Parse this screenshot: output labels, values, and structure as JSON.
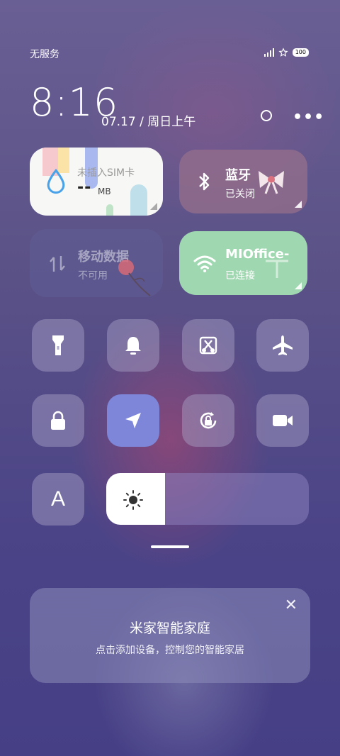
{
  "status": {
    "carrier": "无服务",
    "battery": "100"
  },
  "clock": {
    "time": "8:16",
    "date": "07.17 / 周日上午"
  },
  "tiles": {
    "data": {
      "title": "未插入SIM卡",
      "value": "--",
      "unit": "MB"
    },
    "bluetooth": {
      "title": "蓝牙",
      "status": "已关闭"
    },
    "mobile": {
      "title": "移动数据",
      "status": "不可用"
    },
    "wifi": {
      "title": "MIOffice-",
      "status": "已连接"
    }
  },
  "toggles": [
    {
      "name": "flashlight-icon",
      "active": false
    },
    {
      "name": "bell-icon",
      "active": false
    },
    {
      "name": "screenshot-icon",
      "active": false
    },
    {
      "name": "airplane-icon",
      "active": false
    },
    {
      "name": "lock-icon",
      "active": false
    },
    {
      "name": "location-icon",
      "active": true
    },
    {
      "name": "rotation-lock-icon",
      "active": false
    },
    {
      "name": "video-camera-icon",
      "active": false
    }
  ],
  "auto_brightness_label": "A",
  "brightness_level": 0.29,
  "mijia": {
    "title": "米家智能家庭",
    "subtitle": "点击添加设备，控制您的智能家居",
    "close": "✕"
  },
  "colors": {
    "active": "#7d86d8",
    "wifi": "#9fd8b0",
    "water": "#4aa3e8"
  }
}
